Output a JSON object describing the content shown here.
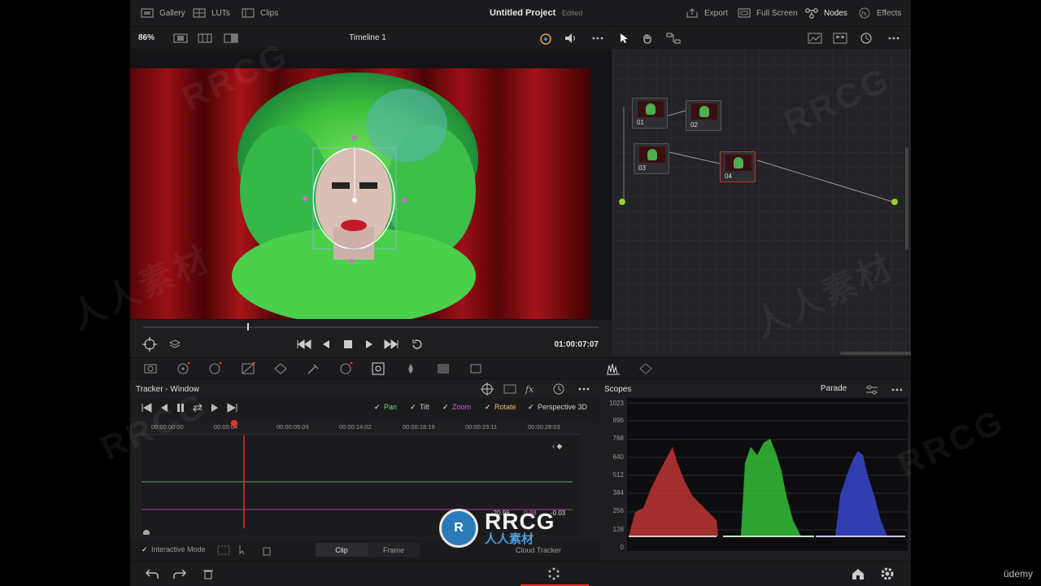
{
  "topbar": {
    "gallery": "Gallery",
    "luts": "LUTs",
    "clips": "Clips",
    "project_title": "Untitled Project",
    "project_status": "Edited",
    "export": "Export",
    "full_screen": "Full Screen",
    "nodes": "Nodes",
    "effects": "Effects"
  },
  "viewer": {
    "zoom": "86%",
    "timeline": "Timeline 1",
    "timecode": "01:00:07:07"
  },
  "nodes": [
    {
      "label": "01"
    },
    {
      "label": "02"
    },
    {
      "label": "03"
    },
    {
      "label": "04"
    }
  ],
  "tracker": {
    "title": "Tracker - Window",
    "options": [
      "Pan",
      "Tilt",
      "Zoom",
      "Rotate",
      "Perspective 3D"
    ],
    "option_colors": [
      "#7fd07f",
      "#d0d0d0",
      "#d15fd1",
      "#e0c060",
      "#d0d0d0"
    ],
    "ruler": [
      "00:00:00:00",
      "00:00:04",
      "00:00:09:09",
      "00:00:14:02",
      "00:00:18:19",
      "00:00:23:11",
      "00:00:28:03"
    ],
    "values": [
      "-20.96",
      "0.98",
      "-0.03"
    ],
    "interactive_mode": "Interactive Mode",
    "seg_clip": "Clip",
    "seg_frame": "Frame",
    "cloud_tracker": "Cloud Tracker"
  },
  "scopes": {
    "title": "Scopes",
    "mode": "Parade",
    "ylabels": [
      "1023",
      "896",
      "768",
      "640",
      "512",
      "384",
      "256",
      "128",
      "0"
    ]
  },
  "watermark": {
    "brand": "RRCG",
    "brand_sub": "人人素材",
    "repeat": "RRCG",
    "repeat_cn": "人人素材"
  },
  "footer": {
    "udemy": "ūdemy"
  },
  "colors": {
    "accent_red": "#e0352b",
    "bg": "#1e1e21"
  }
}
